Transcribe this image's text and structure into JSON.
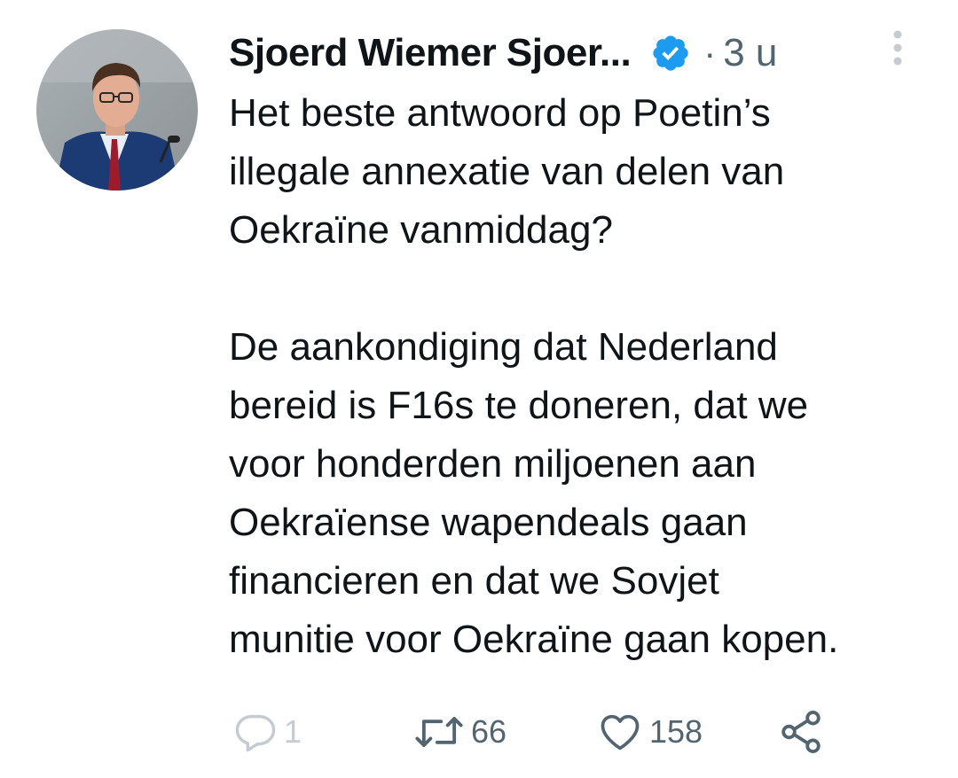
{
  "tweet": {
    "author_name": "Sjoerd Wiemer Sjoer...",
    "separator": "·",
    "timestamp": "3 u",
    "text": "Het beste antwoord op Poetin’s\nillegale annexatie van delen van\nOekraïne vanmiddag?\n\nDe aankondiging dat Nederland\nbereid is F16s te doneren, dat we\nvoor honderden miljoenen aan\nOekraïense wapendeals gaan\nfinancieren en dat we Sovjet\nmunitie voor Oekraïne gaan kopen."
  },
  "actions": {
    "reply_count": "1",
    "retweet_count": "66",
    "like_count": "158"
  },
  "colors": {
    "text": "#0f1419",
    "secondary": "#536471",
    "verified_blue": "#1d9bf0",
    "background": "#ffffff"
  },
  "icons": {
    "verified": "verified-badge-icon",
    "more": "more-vertical-icon",
    "reply": "reply-bubble-icon",
    "retweet": "retweet-icon",
    "like": "heart-icon",
    "share": "share-icon"
  }
}
